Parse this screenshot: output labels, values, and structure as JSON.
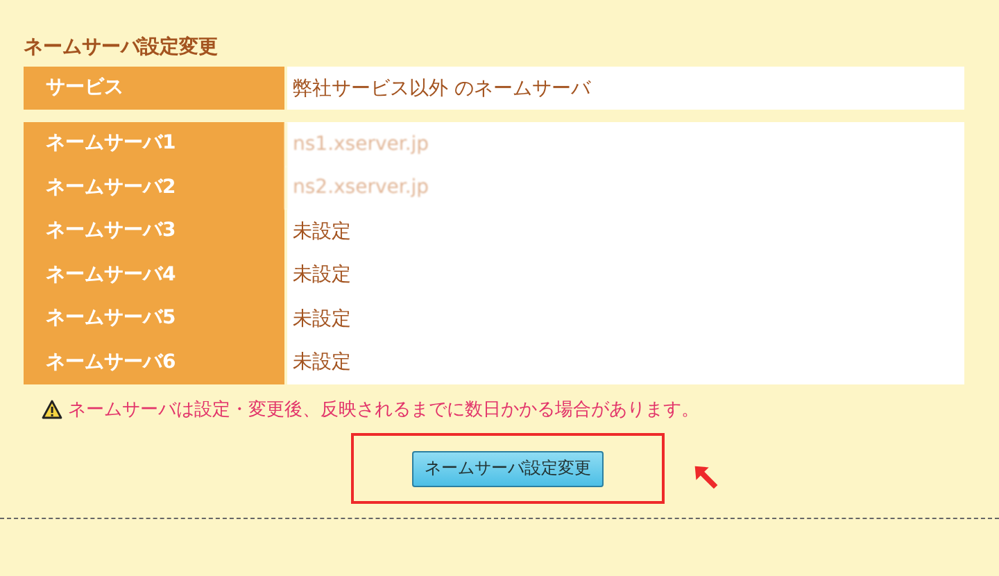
{
  "title": "ネームサーバ設定変更",
  "service": {
    "label": "サービス",
    "value": "弊社サービス以外 のネームサーバ"
  },
  "nameservers": [
    {
      "label": "ネームサーバ1",
      "value": "ns1.xserver.jp",
      "blurred": true
    },
    {
      "label": "ネームサーバ2",
      "value": "ns2.xserver.jp",
      "blurred": true
    },
    {
      "label": "ネームサーバ3",
      "value": "未設定",
      "blurred": false
    },
    {
      "label": "ネームサーバ4",
      "value": "未設定",
      "blurred": false
    },
    {
      "label": "ネームサーバ5",
      "value": "未設定",
      "blurred": false
    },
    {
      "label": "ネームサーバ6",
      "value": "未設定",
      "blurred": false
    }
  ],
  "warning": "ネームサーバは設定・変更後、反映されるまでに数日かかる場合があります。",
  "submit_button": {
    "label": "ネームサーバ設定変更",
    "highlighted": true
  }
}
